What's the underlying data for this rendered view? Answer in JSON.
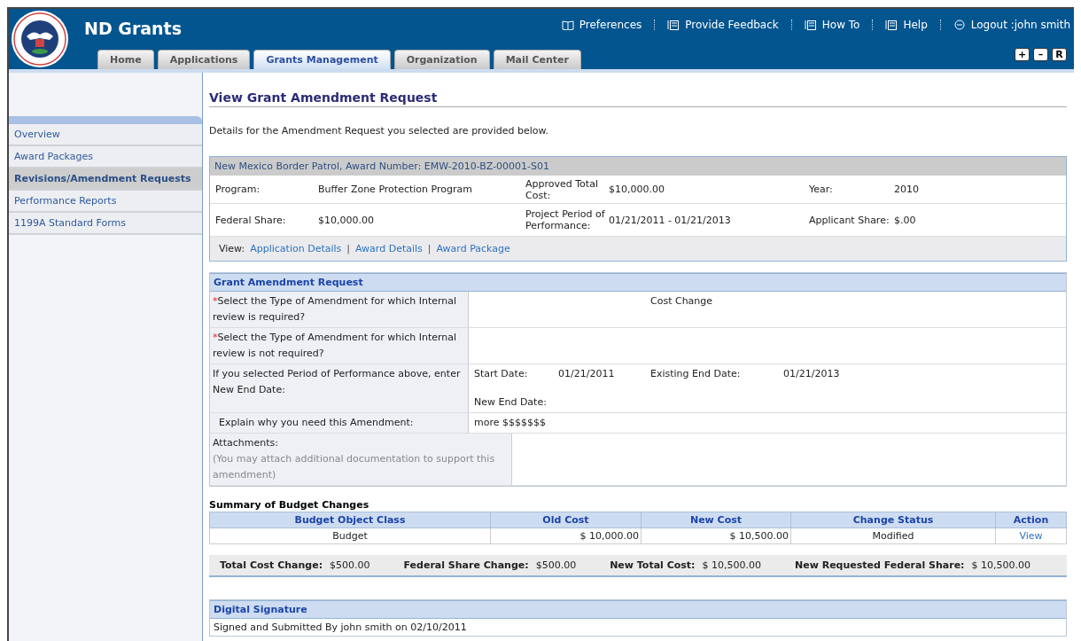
{
  "app": {
    "title": "ND Grants"
  },
  "header_links": [
    {
      "kind": "book",
      "label": "Preferences"
    },
    {
      "kind": "doc",
      "label": "Provide Feedback"
    },
    {
      "kind": "doc",
      "label": "How To"
    },
    {
      "kind": "doc",
      "label": "Help"
    },
    {
      "kind": "logout",
      "label": "Logout :john smith"
    }
  ],
  "tabs": [
    {
      "label": "Home",
      "selected": false
    },
    {
      "label": "Applications",
      "selected": false
    },
    {
      "label": "Grants Management",
      "selected": true
    },
    {
      "label": "Organization",
      "selected": false
    },
    {
      "label": "Mail Center",
      "selected": false
    }
  ],
  "size_buttons": [
    "+",
    "–",
    "R"
  ],
  "sidebar": {
    "items": [
      {
        "label": "Overview",
        "selected": false
      },
      {
        "label": "Award Packages",
        "selected": false
      },
      {
        "label": "Revisions/Amendment Requests",
        "selected": true
      },
      {
        "label": "Performance Reports",
        "selected": false
      },
      {
        "label": "1199A Standard Forms",
        "selected": false
      }
    ]
  },
  "page_title": "View Grant Amendment Request",
  "intro": "Details for the Amendment Request you selected are provided below.",
  "award": {
    "header": "New Mexico Border Patrol, Award Number: EMW-2010-BZ-00001-S01",
    "rows": [
      [
        {
          "label": "Program:",
          "value": "Buffer Zone Protection Program"
        },
        {
          "label": "Approved Total Cost:",
          "value": "$10,000.00"
        },
        {
          "label": "Year:",
          "value": "2010"
        }
      ],
      [
        {
          "label": "Federal Share:",
          "value": "$10,000.00"
        },
        {
          "label": "Project Period of Performance:",
          "value": "01/21/2011 - 01/21/2013"
        },
        {
          "label": "Applicant Share:",
          "value": "$.00"
        }
      ]
    ],
    "view_label": "View:",
    "view_links": [
      "Application Details",
      "Award Details",
      "Award Package"
    ],
    "view_separators": [
      "|",
      "|"
    ]
  },
  "amendment": {
    "title": "Grant Amendment Request",
    "rows": [
      {
        "kind": "text",
        "marker": "*",
        "label": "Select the Type of Amendment for which Internal review is required?",
        "value": "Cost Change"
      },
      {
        "kind": "text",
        "marker": "*",
        "label": "Select the Type of Amendment for which Internal review is not required?"
      },
      {
        "kind": "dates",
        "label": "If you selected Period of Performance above, enter New End Date:",
        "start_label": "Start Date:",
        "start_value": "01/21/2011",
        "end_label": "Existing End Date:",
        "end_value": "01/21/2013",
        "new_end_label": "New End Date:"
      },
      {
        "kind": "text",
        "label": "Explain why you need this Amendment:",
        "value": "more $$$$$$$"
      },
      {
        "kind": "attachments",
        "label": "Attachments:",
        "hint": "(You may attach additional documentation to support this amendment)"
      }
    ]
  },
  "budget": {
    "title": "Summary of Budget Changes",
    "columns": [
      "Budget Object Class",
      "Old Cost",
      "New Cost",
      "Change Status",
      "Action"
    ],
    "rows": [
      {
        "cells": [
          "Budget",
          "$ 10,000.00",
          "$ 10,500.00",
          "Modified"
        ],
        "action": "View"
      }
    ],
    "totals": [
      {
        "label": "Total Cost Change:",
        "value": "$500.00"
      },
      {
        "label": "Federal Share Change:",
        "value": "$500.00"
      },
      {
        "label": "New Total Cost:",
        "value": "$ 10,500.00"
      },
      {
        "label": "New Requested Federal Share:",
        "value": "$ 10,500.00"
      }
    ]
  },
  "signature": {
    "title": "Digital Signature",
    "text": "Signed and Submitted By john smith on 02/10/2011"
  }
}
